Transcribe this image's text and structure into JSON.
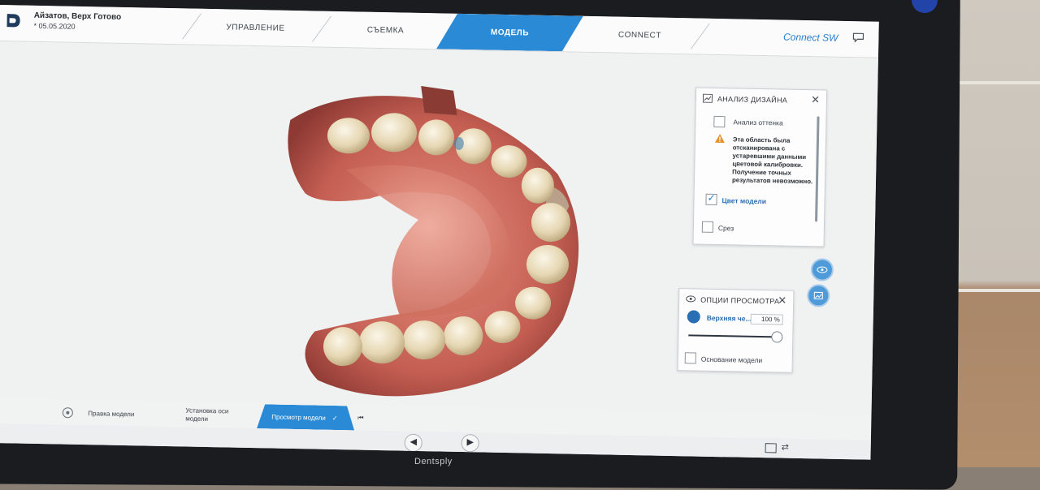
{
  "header": {
    "patient_name": "Айзатов, Верх Готово",
    "patient_date": "* 05.05.2020",
    "tabs": [
      "УПРАВЛЕНИЕ",
      "СЪЕМКА",
      "МОДЕЛЬ",
      "CONNECT"
    ],
    "active_tab": "МОДЕЛЬ",
    "connect_sw": "Connect SW"
  },
  "design_panel": {
    "title": "АНАЛИЗ ДИЗАЙНА",
    "shade_label": "Анализ оттенка",
    "warning": "Эта область была отсканирована с устаревшими данными цветовой калибровки. Получение точных результатов невозможно.",
    "model_color_label": "Цвет модели",
    "model_color_checked": true,
    "section_label": "Срез"
  },
  "view_panel": {
    "title": "ОПЦИИ ПРОСМОТРА",
    "layer_label": "Верхняя че...",
    "percent": "100 %",
    "slider_value": 1.0,
    "base_label": "Основание модели"
  },
  "workflow": {
    "steps": [
      "Правка модели",
      "Установка оси модели",
      "Просмотр модели"
    ],
    "active": "Просмотр модели"
  },
  "brand": "Dentsply",
  "colors": {
    "accent": "#2a8ad6",
    "gum": "#c86a5e",
    "tooth": "#e8dcc0"
  }
}
